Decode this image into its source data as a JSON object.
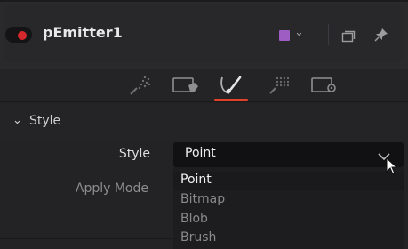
{
  "node": {
    "name": "pEmitter1",
    "color": "#9d5dc2"
  },
  "tabs": [
    {
      "name": "controls",
      "icon": "particles-icon",
      "active": false
    },
    {
      "name": "sets",
      "icon": "tag-icon",
      "active": false
    },
    {
      "name": "style",
      "icon": "brush-icon",
      "active": true
    },
    {
      "name": "region",
      "icon": "region-particles-icon",
      "active": false
    },
    {
      "name": "settings",
      "icon": "settings-icon",
      "active": false
    }
  ],
  "section": {
    "title": "Style"
  },
  "fields": {
    "style_label": "Style",
    "apply_mode_label": "Apply Mode"
  },
  "combo": {
    "value": "Point",
    "options": [
      "Point",
      "Bitmap",
      "Blob",
      "Brush"
    ]
  }
}
